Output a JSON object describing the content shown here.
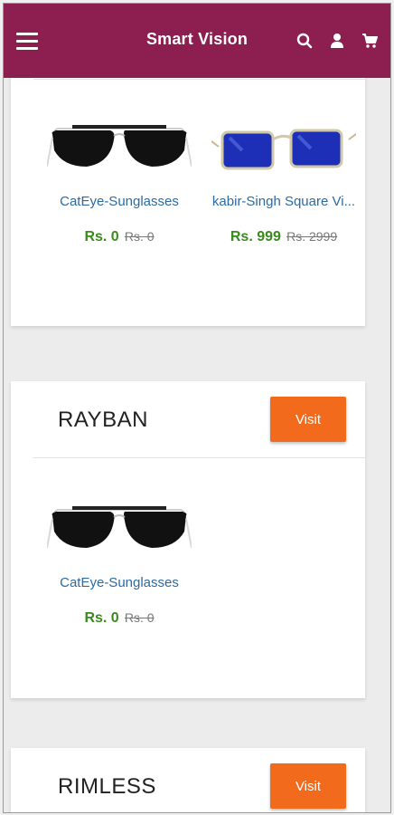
{
  "app": {
    "title": "Smart Vision"
  },
  "header": {
    "icons": [
      "menu-icon",
      "search-icon",
      "user-icon",
      "cart-icon"
    ]
  },
  "sections": [
    {
      "products": [
        {
          "name": "CatEye-Sunglasses",
          "price": "Rs. 0",
          "old_price": "Rs. 0"
        },
        {
          "name": "kabir-Singh Square Vi...",
          "price": "Rs. 999",
          "old_price": "Rs. 2999"
        }
      ]
    },
    {
      "brand": "RAYBAN",
      "visit_label": "Visit",
      "products": [
        {
          "name": "CatEye-Sunglasses",
          "price": "Rs. 0",
          "old_price": "Rs. 0"
        }
      ]
    },
    {
      "brand": "RIMLESS",
      "visit_label": "Visit"
    }
  ],
  "colors": {
    "topbar": "#8c1f4f",
    "visit_button": "#f26b1d",
    "product_name": "#2c6aa2",
    "price": "#3a8a1e"
  }
}
